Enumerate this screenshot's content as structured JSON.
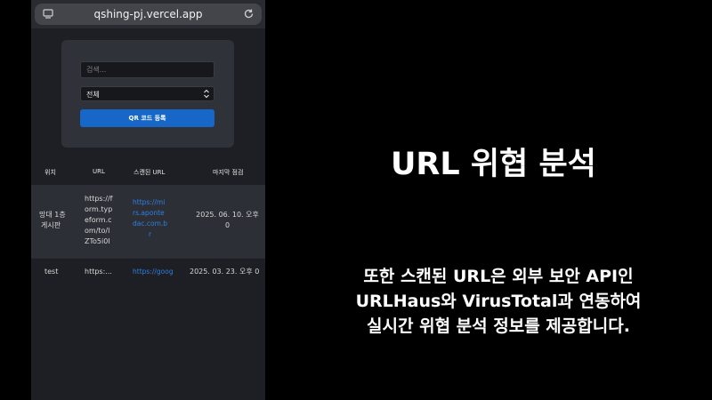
{
  "browser": {
    "url": "qshing-pj.vercel.app"
  },
  "controls": {
    "search_placeholder": "검색...",
    "filter_selected": "전체",
    "register_button": "QR 코드 등록"
  },
  "table": {
    "headers": [
      "위치",
      "URL",
      "스캔된 URL",
      "마지막 점검"
    ],
    "rows": [
      {
        "location_lines": [
          "망대 1층",
          "게시판"
        ],
        "url_lines": [
          "https://f",
          "orm.typ",
          "eform.c",
          "om/to/l",
          "ZTo5i0I"
        ],
        "scanned_url_lines": [
          "https://mi",
          "rs.aponte",
          "dac.com.b",
          "r"
        ],
        "last_check_lines": [
          "2025. 06. 10. 오후",
          "0"
        ]
      },
      {
        "location_lines": [
          "test"
        ],
        "url_lines": [
          "https:..."
        ],
        "scanned_url_lines": [
          "https://goog"
        ],
        "last_check_lines": [
          "2025. 03. 23. 오후 0"
        ]
      }
    ]
  },
  "caption": {
    "title": "URL 위협 분석",
    "lines": [
      "또한 스캔된 URL은 외부 보안 API인",
      "URLHaus와 VirusTotal과 연동하여",
      "실시간 위협 분석 정보를 제공합니다."
    ]
  },
  "colors": {
    "accent": "#1667c7",
    "link": "#2f7fe0",
    "background": "#000000",
    "panel": "#30323a"
  }
}
